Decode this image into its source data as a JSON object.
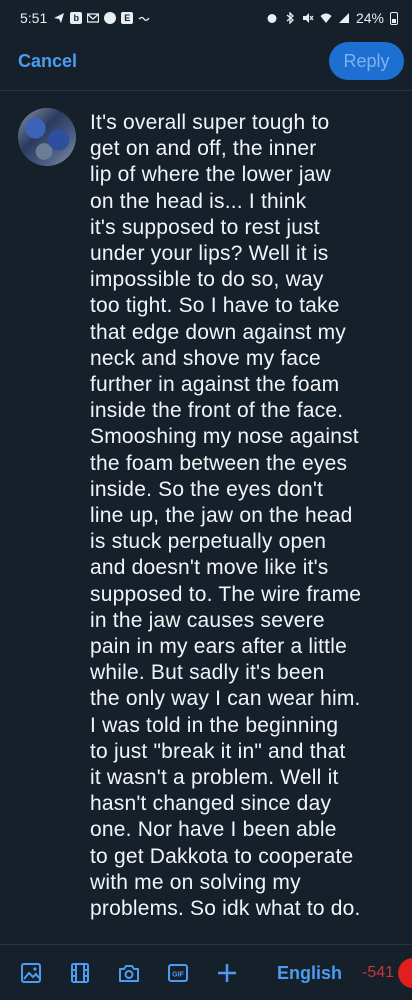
{
  "status_bar": {
    "time": "5:51",
    "battery": "24%"
  },
  "header": {
    "cancel_label": "Cancel",
    "reply_label": "Reply"
  },
  "post": {
    "text": "It's overall super tough to\nget on and off, the inner\nlip of where the lower jaw\non the head is... I think\nit's supposed to rest just\nunder your lips? Well it is\nimpossible to do so, way\ntoo tight. So I have to take\nthat edge down against my\nneck and shove my face\nfurther in against the foam\ninside the front of the face.\nSmooshing my nose against\nthe foam between the eyes\ninside. So the eyes don't\nline up, the jaw on the head\nis stuck perpetually open\nand doesn't move like it's\nsupposed to. The wire frame\nin the jaw causes severe\npain in my ears after a little\nwhile. But sadly it's been\nthe only way I can wear him.\nI was told in the beginning\nto just \"break it in\" and that\nit wasn't a problem. Well it\nhasn't changed since day\none. Nor have I been able\nto get Dakkota to cooperate\nwith me on solving my\nproblems. So idk what to do."
  },
  "toolbar": {
    "icons": [
      "image-icon",
      "video-icon",
      "camera-icon",
      "gif-icon",
      "plus-icon"
    ],
    "language": "English",
    "char_count": "-541"
  },
  "colors": {
    "background": "#16202b",
    "accent": "#4a9df0",
    "reply_button": "#1d6fd1",
    "over_limit": "#e01f1f"
  }
}
